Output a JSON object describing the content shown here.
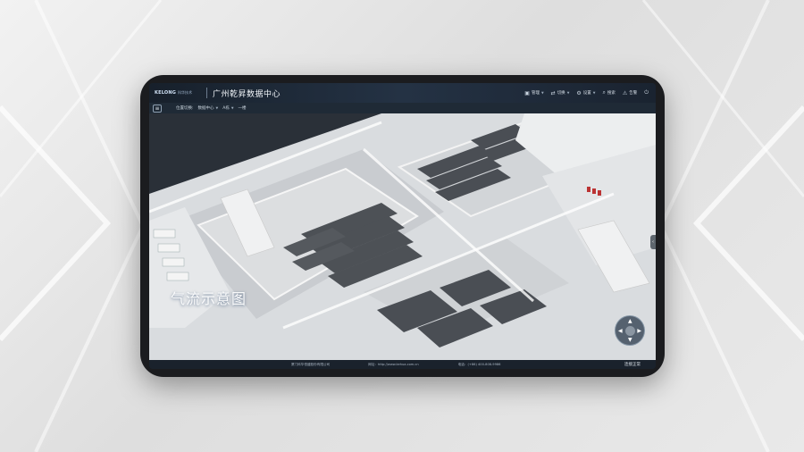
{
  "window": {
    "logo_text": "KELONG",
    "logo_sub": "科华技术",
    "title": "广州乾昇数据中心"
  },
  "top_actions": [
    {
      "icon": "monitor-icon",
      "label": "管理"
    },
    {
      "icon": "transfer-icon",
      "label": "切换"
    },
    {
      "icon": "settings-icon",
      "label": "设置"
    },
    {
      "icon": "search-icon",
      "label": "搜索"
    },
    {
      "icon": "alert-icon",
      "label": "告警"
    }
  ],
  "breadcrumb": {
    "label": "位置切换:",
    "items": [
      "数据中心",
      "A栋",
      "一楼"
    ]
  },
  "overlay_title": "气流示意图",
  "footer": {
    "company": "厦门科华恒盛股份有限公司",
    "website": "网址：http://www.kehua.com.cn",
    "phone": "电话：(+86) 400-808-9986",
    "status": "连接正常"
  },
  "colors": {
    "accent": "#5a87b8",
    "topbar": "#243244",
    "floor": "#e6e8ea",
    "rack": "#4a4e54"
  }
}
